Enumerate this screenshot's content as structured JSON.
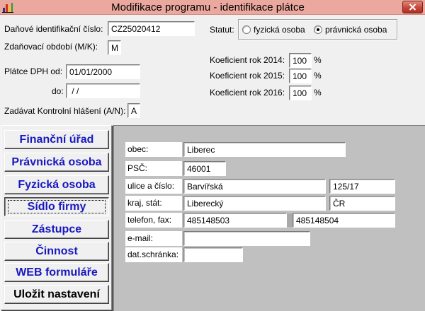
{
  "colors": {
    "title_bar": "#eba89f",
    "close_button": "#c7463a",
    "form_bg": "#f0f0f0",
    "panel_bg": "#c0c0c0",
    "nav_text": "#1818c0",
    "nav_text_save": "#000000"
  },
  "window": {
    "title": "Modifikace programu - identifikace plátce",
    "app_icon": "bar-chart-icon",
    "close_icon": "close-icon"
  },
  "header": {
    "dic": {
      "label": "Daňové identifikační číslo:",
      "value": "CZ25020412"
    },
    "period": {
      "label": "Zdaňovací období (M/K):",
      "value": "M"
    },
    "vat_from": {
      "label": "Plátce DPH od:",
      "value": "01/01/2000"
    },
    "vat_to": {
      "label": "do:",
      "value": " / /"
    },
    "control_report": {
      "label": "Zadávat Kontrolní hlášení (A/N):",
      "value": "A"
    },
    "status": {
      "label": "Statut:",
      "options": [
        {
          "label": "fyzická osoba",
          "selected": false
        },
        {
          "label": "právnická osoba",
          "selected": true
        }
      ]
    },
    "coefficients": [
      {
        "label": "Koeficient rok 2014:",
        "value": "100",
        "unit": "%"
      },
      {
        "label": "Koeficient rok 2015:",
        "value": "100",
        "unit": "%"
      },
      {
        "label": "Koeficient rok 2016:",
        "value": "100",
        "unit": "%"
      }
    ]
  },
  "nav": {
    "buttons": [
      {
        "label": "Finanční úřad",
        "active": false
      },
      {
        "label": "Právnická osoba",
        "active": false
      },
      {
        "label": "Fyzická osoba",
        "active": false
      },
      {
        "label": "Sídlo firmy",
        "active": true
      },
      {
        "label": "Zástupce",
        "active": false
      },
      {
        "label": "Činnost",
        "active": false
      },
      {
        "label": "WEB formuláře",
        "active": false
      },
      {
        "label": "Uložit nastavení",
        "active": false
      }
    ]
  },
  "address": {
    "city": {
      "label": "obec:",
      "value": "Liberec"
    },
    "zip": {
      "label": "PSČ:",
      "value": "46001"
    },
    "street": {
      "label": "ulice a číslo:",
      "value": "Barvířská",
      "number": "125/17"
    },
    "region": {
      "label": "kraj, stát:",
      "value": "Liberecký",
      "country": "ČR"
    },
    "phone": {
      "label": "telefon, fax:",
      "value": "485148503",
      "fax": "485148504"
    },
    "email": {
      "label": "e-mail:",
      "value": ""
    },
    "databox": {
      "label": "dat.schránka:",
      "value": ""
    }
  }
}
